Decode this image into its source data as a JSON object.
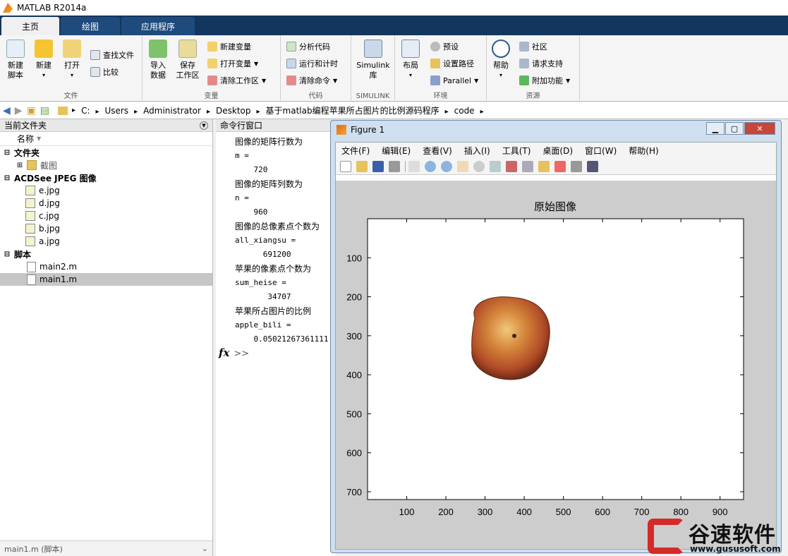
{
  "app": {
    "title": "MATLAB R2014a"
  },
  "tabs": [
    {
      "label": "主页"
    },
    {
      "label": "绘图"
    },
    {
      "label": "应用程序"
    }
  ],
  "ribbon": {
    "new_script": "新建\n脚本",
    "new": "新建",
    "open": "打开",
    "find_files": "查找文件",
    "compare": "比较",
    "import_data": "导入\n数据",
    "save_workspace": "保存\n工作区",
    "new_variable": "新建变量",
    "open_variable": "打开变量",
    "clear_workspace": "清除工作区",
    "analyze_code": "分析代码",
    "run_and_time": "运行和计时",
    "clear_commands": "清除命令",
    "simulink_library": "Simulink\n库",
    "layout": "布局",
    "preferences": "预设",
    "set_path": "设置路径",
    "parallel": "Parallel",
    "help": "帮助",
    "community": "社区",
    "request_support": "请求支持",
    "add_ons": "附加功能",
    "group_file": "文件",
    "group_variable": "变量",
    "group_code": "代码",
    "group_simulink": "SIMULINK",
    "group_environment": "环境",
    "group_resources": "资源"
  },
  "address": {
    "path": [
      "C:",
      "Users",
      "Administrator",
      "Desktop",
      "基于matlab编程苹果所占图片的比例源码程序",
      "code"
    ]
  },
  "file_browser": {
    "title": "当前文件夹",
    "column_name": "名称",
    "sections": [
      {
        "label": "文件夹",
        "items": [
          "截图"
        ]
      },
      {
        "label": "ACDSee JPEG 图像",
        "items": [
          "e.jpg",
          "d.jpg",
          "c.jpg",
          "b.jpg",
          "a.jpg"
        ]
      },
      {
        "label": "脚本",
        "items": [
          "main2.m",
          "main1.m"
        ]
      }
    ],
    "footer": "main1.m (脚本)"
  },
  "command_window": {
    "title": "命令行窗口",
    "lines": [
      "图像的矩阵行数为",
      "m =",
      "    720",
      "图像的矩阵列数为",
      "n =",
      "    960",
      "图像的总像素点个数为",
      "all_xiangsu =",
      "      691200",
      "苹果的像素点个数为",
      "sum_heise =",
      "       34707",
      "苹果所占图片的比例",
      "apple_bili =",
      "    0.05021267361111"
    ],
    "prompt_symbol": "fx",
    "prompt": ">>"
  },
  "figure": {
    "title": "Figure 1",
    "menu": [
      "文件(F)",
      "编辑(E)",
      "查看(V)",
      "插入(I)",
      "工具(T)",
      "桌面(D)",
      "窗口(W)",
      "帮助(H)"
    ],
    "axes_title": "原始图像",
    "xticks": [
      100,
      200,
      300,
      400,
      500,
      600,
      700,
      800,
      900
    ],
    "yticks": [
      100,
      200,
      300,
      400,
      500,
      600,
      700
    ],
    "xlim": [
      0,
      960
    ],
    "ylim": [
      0,
      720
    ]
  },
  "watermark": {
    "brand": "谷速软件",
    "url": "www.gususoft.com"
  },
  "colors": {
    "tab_bar": "#12365e",
    "accent": "#3a6fb0",
    "watermark_red": "#d42a2a"
  }
}
